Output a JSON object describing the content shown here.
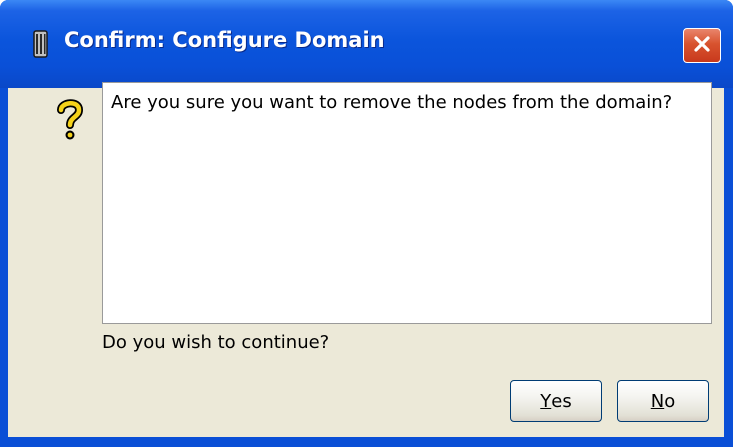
{
  "window": {
    "title": "Confirm: Configure Domain",
    "title_icon": "server-icon",
    "close_icon": "close-icon",
    "accent_color": "#0a50d8",
    "close_color": "#d8532f"
  },
  "dialog": {
    "icon": "question-icon",
    "message": "Are you sure you want to remove the nodes from the domain?",
    "prompt": "Do you wish to continue?"
  },
  "buttons": {
    "yes": {
      "mnemonic": "Y",
      "rest": "es"
    },
    "no": {
      "mnemonic": "N",
      "rest": "o"
    }
  }
}
